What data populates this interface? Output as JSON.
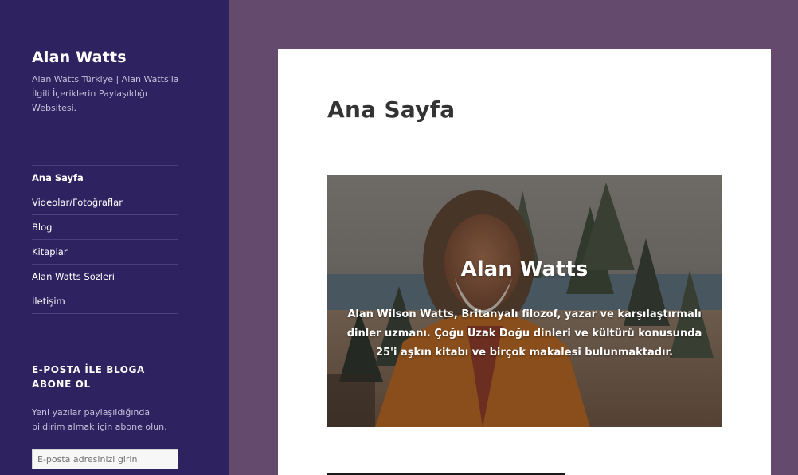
{
  "site": {
    "title": "Alan Watts",
    "description": "Alan Watts Türkiye | Alan Watts'la İlgili İçeriklerin Paylaşıldığı Websitesi."
  },
  "nav": {
    "items": [
      {
        "label": "Ana Sayfa",
        "current": true
      },
      {
        "label": "Videolar/Fotoğraflar"
      },
      {
        "label": "Blog"
      },
      {
        "label": "Kitaplar"
      },
      {
        "label": "Alan Watts Sözleri"
      },
      {
        "label": "İletişim"
      }
    ]
  },
  "widget": {
    "title": "E-POSTA İLE BLOGA ABONE OL",
    "text": "Yeni yazılar paylaşıldığında bildirim almak için abone olun.",
    "email_placeholder": "E-posta adresinizi girin"
  },
  "page": {
    "title": "Ana Sayfa"
  },
  "cover": {
    "title": "Alan Watts",
    "text": "Alan Wilson Watts, Britanyalı filozof, yazar ve karşılaştırmalı dinler uzmanı. Çoğu Uzak Doğu dinleri ve kültürü konusunda 25'i aşkın kitabı ve birçok makalesi bulunmaktadır."
  },
  "colors": {
    "sidebar_bg": "#2f2260",
    "page_bg": "#644a6d",
    "card_bg": "#ffffff"
  }
}
